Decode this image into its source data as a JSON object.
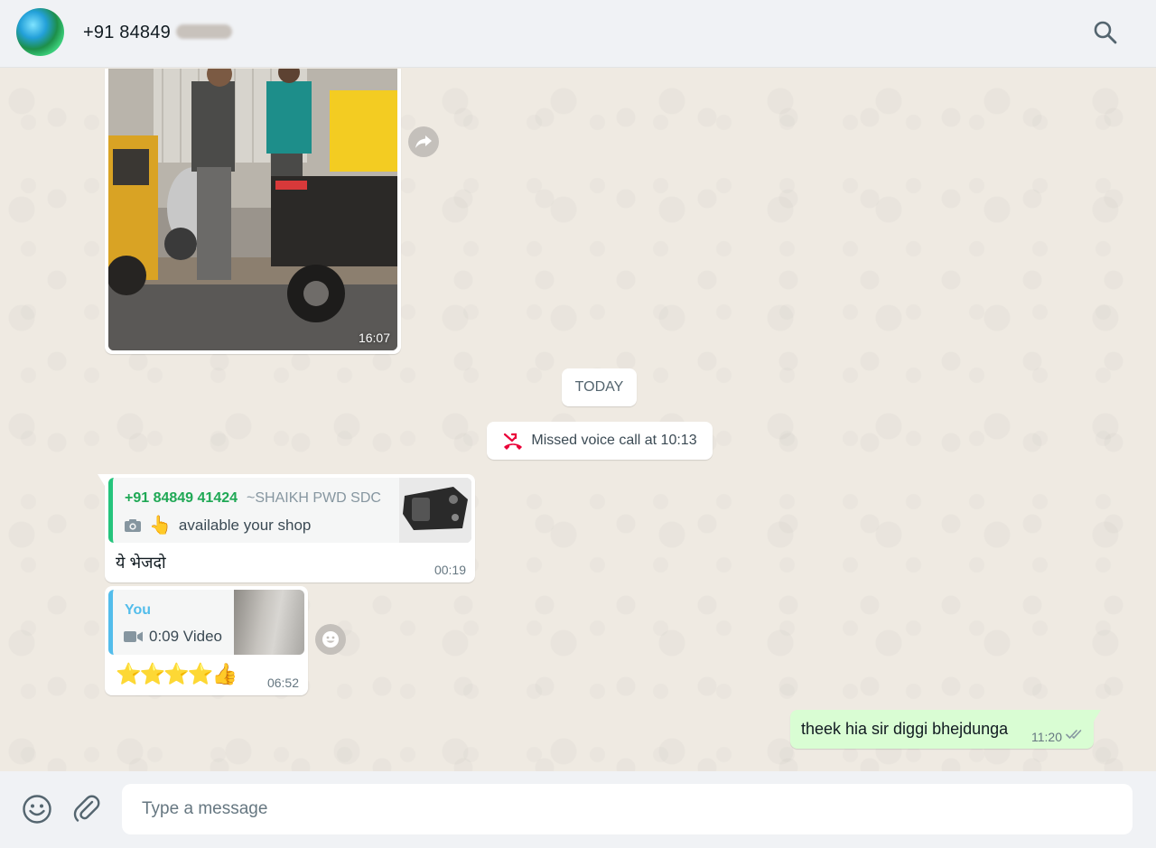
{
  "header": {
    "contact_name": "+91 84849"
  },
  "messages": {
    "image_time": "16:07",
    "date_divider": "TODAY",
    "missed_call": "Missed voice call at 10:13",
    "msg1": {
      "quote_sender": "+91 84849 41424",
      "quote_sender_name": "~SHAIKH PWD SDC",
      "quote_text": "available your shop",
      "text": "ये भेजदो",
      "time": "00:19"
    },
    "msg2": {
      "quote_sender": "You",
      "quote_text": "0:09 Video",
      "text": "⭐⭐⭐⭐👍",
      "time": "06:52"
    },
    "msg3": {
      "text": "theek hia sir diggi bhejdunga",
      "time": "11:20"
    }
  },
  "composer": {
    "placeholder": "Type a message"
  },
  "colors": {
    "header_bg": "#f0f2f5",
    "chat_bg": "#efeae2",
    "outgoing_bubble": "#d9fdd3",
    "quote_green": "#1fa855",
    "quote_blue": "#53bdeb",
    "missed_call_red": "#ea0038"
  }
}
